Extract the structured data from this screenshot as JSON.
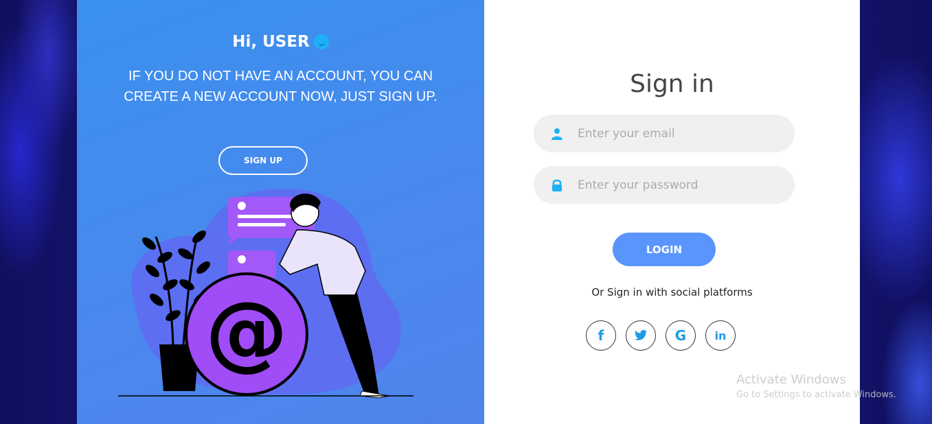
{
  "left_panel": {
    "greeting": "Hi, USER",
    "blurb": "IF YOU DO NOT HAVE AN ACCOUNT, YOU CAN CREATE A NEW ACCOUNT NOW, JUST SIGN UP.",
    "signup_label": "SIGN UP"
  },
  "form": {
    "title": "Sign in",
    "email": {
      "placeholder": "Enter your email",
      "value": ""
    },
    "password": {
      "placeholder": "Enter your password",
      "value": ""
    },
    "login_label": "LOGIN",
    "social_text": "Or Sign in with social platforms",
    "socials": [
      {
        "icon": "facebook-icon",
        "glyph": "f"
      },
      {
        "icon": "twitter-icon",
        "glyph": ""
      },
      {
        "icon": "google-icon",
        "glyph": "G"
      },
      {
        "icon": "linkedin-icon",
        "glyph": "in"
      }
    ]
  },
  "watermark": {
    "line1": "Activate Windows",
    "line2": "Go to Settings to activate Windows."
  },
  "colors": {
    "panel_blue": "#3a90ee",
    "login_button": "#5995fd",
    "icon_cyan": "#1eb0f7"
  }
}
